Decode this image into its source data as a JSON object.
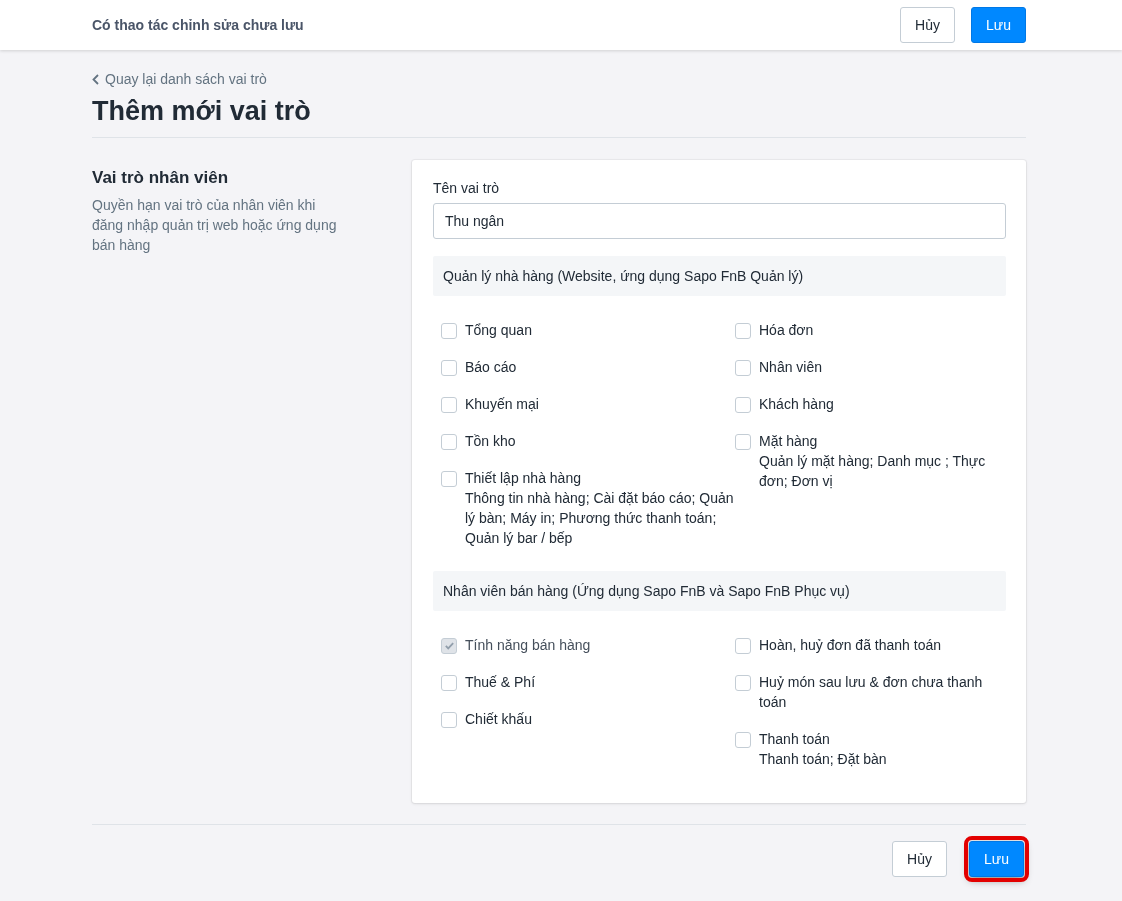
{
  "top_bar": {
    "message": "Có thao tác chỉnh sửa chưa lưu",
    "cancel": "Hủy",
    "save": "Lưu"
  },
  "back_link": "Quay lại danh sách vai trò",
  "page_title": "Thêm mới vai trò",
  "intro": {
    "title": "Vai trò nhân viên",
    "description": "Quyền hạn vai trò của nhân viên khi đăng nhập quản trị web hoặc ứng dụng bán hàng"
  },
  "role_name": {
    "label": "Tên vai trò",
    "value": "Thu ngân"
  },
  "sections": [
    {
      "title": "Quản lý nhà hàng (Website, ứng dụng Sapo FnB Quản lý)",
      "columns": [
        [
          {
            "label": "Tổng quan",
            "checked": false,
            "disabled": false
          },
          {
            "label": "Báo cáo",
            "checked": false,
            "disabled": false
          },
          {
            "label": "Khuyến mại",
            "checked": false,
            "disabled": false
          },
          {
            "label": "Tồn kho",
            "checked": false,
            "disabled": false
          },
          {
            "label": "Thiết lập nhà hàng",
            "description": "Thông tin nhà hàng; Cài đặt báo cáo; Quản lý bàn; Máy in; Phương thức thanh toán; Quản lý bar / bếp",
            "checked": false,
            "disabled": false
          }
        ],
        [
          {
            "label": "Hóa đơn",
            "checked": false,
            "disabled": false
          },
          {
            "label": "Nhân viên",
            "checked": false,
            "disabled": false
          },
          {
            "label": "Khách hàng",
            "checked": false,
            "disabled": false
          },
          {
            "label": "Mặt hàng",
            "description": "Quản lý mặt hàng; Danh mục ; Thực đơn; Đơn vị",
            "checked": false,
            "disabled": false
          }
        ]
      ]
    },
    {
      "title": "Nhân viên bán hàng (Ứng dụng Sapo FnB và Sapo FnB Phục vụ)",
      "columns": [
        [
          {
            "label": "Tính năng bán hàng",
            "checked": true,
            "disabled": true
          },
          {
            "label": "Thuế & Phí",
            "checked": false,
            "disabled": false
          },
          {
            "label": "Chiết khấu",
            "checked": false,
            "disabled": false
          }
        ],
        [
          {
            "label": "Hoàn, huỷ đơn đã thanh toán",
            "checked": false,
            "disabled": false
          },
          {
            "label": "Huỷ món sau lưu & đơn chưa thanh toán",
            "checked": false,
            "disabled": false
          },
          {
            "label": "Thanh toán",
            "description": "Thanh toán; Đặt bàn",
            "checked": false,
            "disabled": false
          }
        ]
      ]
    }
  ],
  "footer": {
    "cancel": "Hủy",
    "save": "Lưu",
    "save_highlighted": true
  }
}
